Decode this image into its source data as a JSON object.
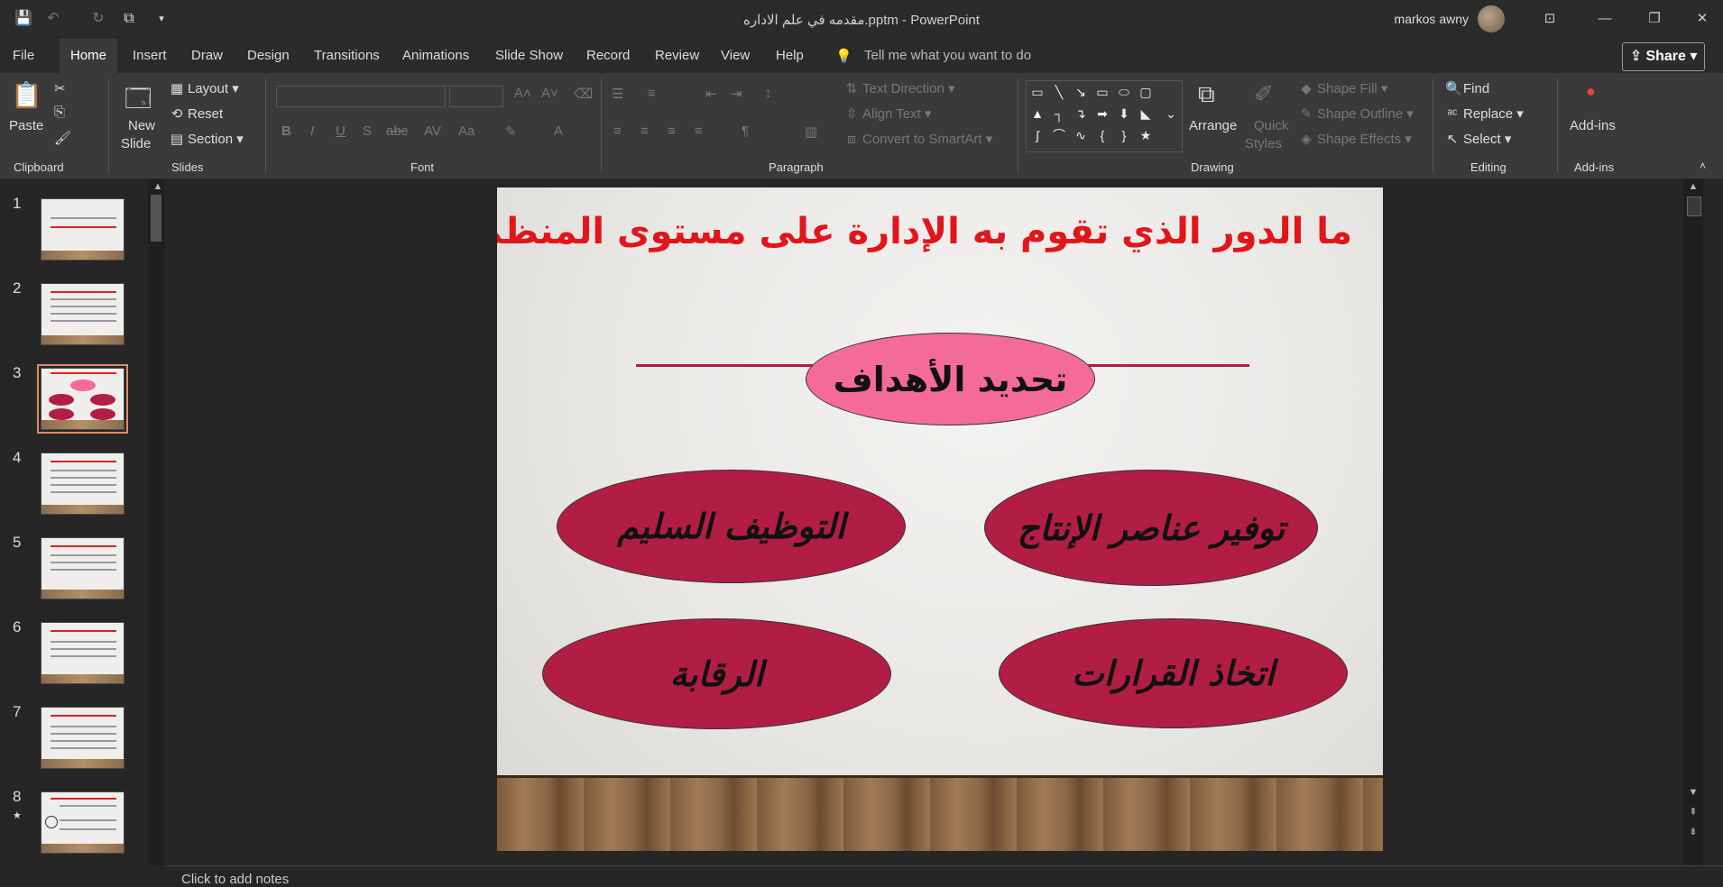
{
  "titlebar": {
    "document_title": "مقدمه في علم الاداره.pptm  -  PowerPoint",
    "user_name": "markos awny",
    "qat": [
      "save-icon",
      "undo-icon",
      "redo-icon",
      "present-icon",
      "customize-icon"
    ]
  },
  "tabs": [
    "File",
    "Home",
    "Insert",
    "Draw",
    "Design",
    "Transitions",
    "Animations",
    "Slide Show",
    "Record",
    "Review",
    "View",
    "Help"
  ],
  "tell_me": "Tell me what you want to do",
  "share_label": "Share",
  "ribbon": {
    "clipboard": {
      "paste": "Paste",
      "label": "Clipboard"
    },
    "slides": {
      "new_slide_1": "New",
      "new_slide_2": "Slide",
      "layout": "Layout",
      "reset": "Reset",
      "section": "Section",
      "label": "Slides"
    },
    "font": {
      "label": "Font"
    },
    "paragraph": {
      "text_direction": "Text Direction",
      "align_text": "Align Text",
      "convert_smartart": "Convert to SmartArt",
      "label": "Paragraph"
    },
    "drawing": {
      "arrange": "Arrange",
      "quick_styles_1": "Quick",
      "quick_styles_2": "Styles",
      "shape_fill": "Shape Fill",
      "shape_outline": "Shape Outline",
      "shape_effects": "Shape Effects",
      "label": "Drawing"
    },
    "editing": {
      "find": "Find",
      "replace": "Replace",
      "select": "Select",
      "label": "Editing"
    },
    "addins": {
      "addins": "Add-ins",
      "label": "Add-ins"
    }
  },
  "thumbnails": [
    {
      "num": "1"
    },
    {
      "num": "2"
    },
    {
      "num": "3"
    },
    {
      "num": "4"
    },
    {
      "num": "5"
    },
    {
      "num": "6"
    },
    {
      "num": "7"
    },
    {
      "num": "8"
    }
  ],
  "slide": {
    "title": "ما الدور الذي تقوم به الإدارة على مستوى المنظمة:-",
    "top": "تحديد الأهداف",
    "mid_left": "التوظيف السليم",
    "mid_right": "توفير عناصر الإنتاج",
    "bottom_left": "الرقابة",
    "bottom_right": "اتخاذ القرارات"
  },
  "notes_placeholder": "Click to add notes",
  "colors": {
    "accent_red": "#e0161c",
    "ellipse_crimson": "#b21d45",
    "ellipse_pink": "#f46a9b"
  }
}
